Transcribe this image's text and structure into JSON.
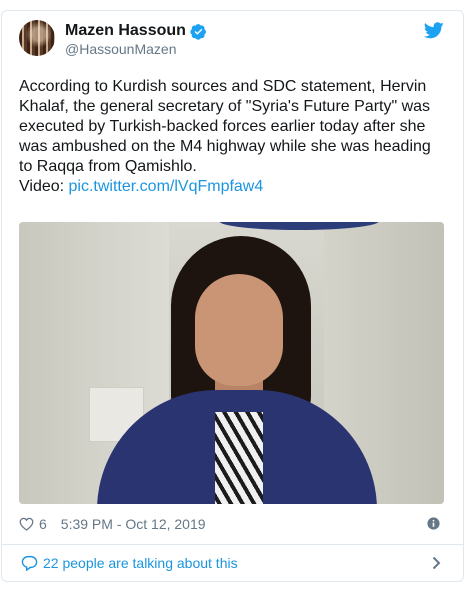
{
  "tweet": {
    "display_name": "Mazen Hassoun",
    "handle": "@HassounMazen",
    "body": "According to Kurdish sources and SDC statement, Hervin Khalaf, the general secretary of \"Syria's Future Party\" was executed by Turkish-backed forces earlier today after she was ambushed on the M4 highway while she was heading to Raqqa from Qamishlo.",
    "video_prefix": "Video: ",
    "video_link": "pic.twitter.com/lVqFmpfaw4",
    "like_count": "6",
    "timestamp": "5:39 PM - Oct 12, 2019"
  },
  "footer": {
    "conversation_label": "22 people are talking about this"
  },
  "icons": {
    "verified": "verified-badge-icon",
    "brand": "twitter-bird-icon",
    "like": "heart-icon",
    "info": "info-icon",
    "comment": "comment-bubble-icon",
    "chevron": "chevron-right-icon"
  },
  "colors": {
    "link": "#1b95e0",
    "muted": "#657786",
    "text": "#14171a",
    "border": "#e1e8ed"
  }
}
